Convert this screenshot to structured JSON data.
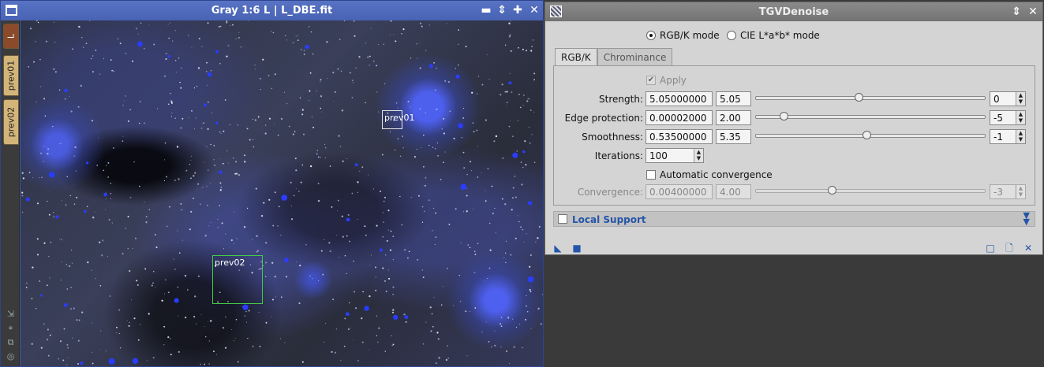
{
  "image_window": {
    "title": "Gray 1:6 L | L_DBE.fit",
    "tabs": {
      "main": "L",
      "preview1": "prev01",
      "preview2": "prev02"
    },
    "previews": [
      {
        "label": "prev01"
      },
      {
        "label": "prev02"
      }
    ],
    "icons": {
      "window": "window-icon",
      "shade": "shade-icon",
      "minimize": "minimize-icon",
      "maximize": "maximize-icon",
      "close": "close-icon"
    }
  },
  "process_window": {
    "title": "TGVDenoise",
    "modes": {
      "rgb": "RGB/K mode",
      "cie": "CIE L*a*b* mode",
      "selected": "rgb"
    },
    "tabs": [
      {
        "label": "RGB/K",
        "active": true
      },
      {
        "label": "Chrominance",
        "active": false
      }
    ],
    "apply": {
      "label": "Apply",
      "checked": true,
      "enabled": false
    },
    "strength": {
      "label": "Strength:",
      "value": "5.05000000",
      "short": "5.05",
      "slider": 0.45,
      "exponent": "0"
    },
    "edge_protection": {
      "label": "Edge protection:",
      "value": "0.00002000",
      "short": "2.00",
      "slider": 0.125,
      "exponent": "-5"
    },
    "smoothness": {
      "label": "Smoothness:",
      "value": "0.53500000",
      "short": "5.35",
      "slider": 0.485,
      "exponent": "-1"
    },
    "iterations": {
      "label": "Iterations:",
      "value": "100"
    },
    "auto_convergence": {
      "label": "Automatic convergence",
      "checked": false
    },
    "convergence": {
      "label": "Convergence:",
      "value": "0.00400000",
      "short": "4.00",
      "slider": 0.335,
      "exponent": "-3",
      "enabled": false
    },
    "local_support": {
      "label": "Local Support",
      "checked": false
    }
  }
}
